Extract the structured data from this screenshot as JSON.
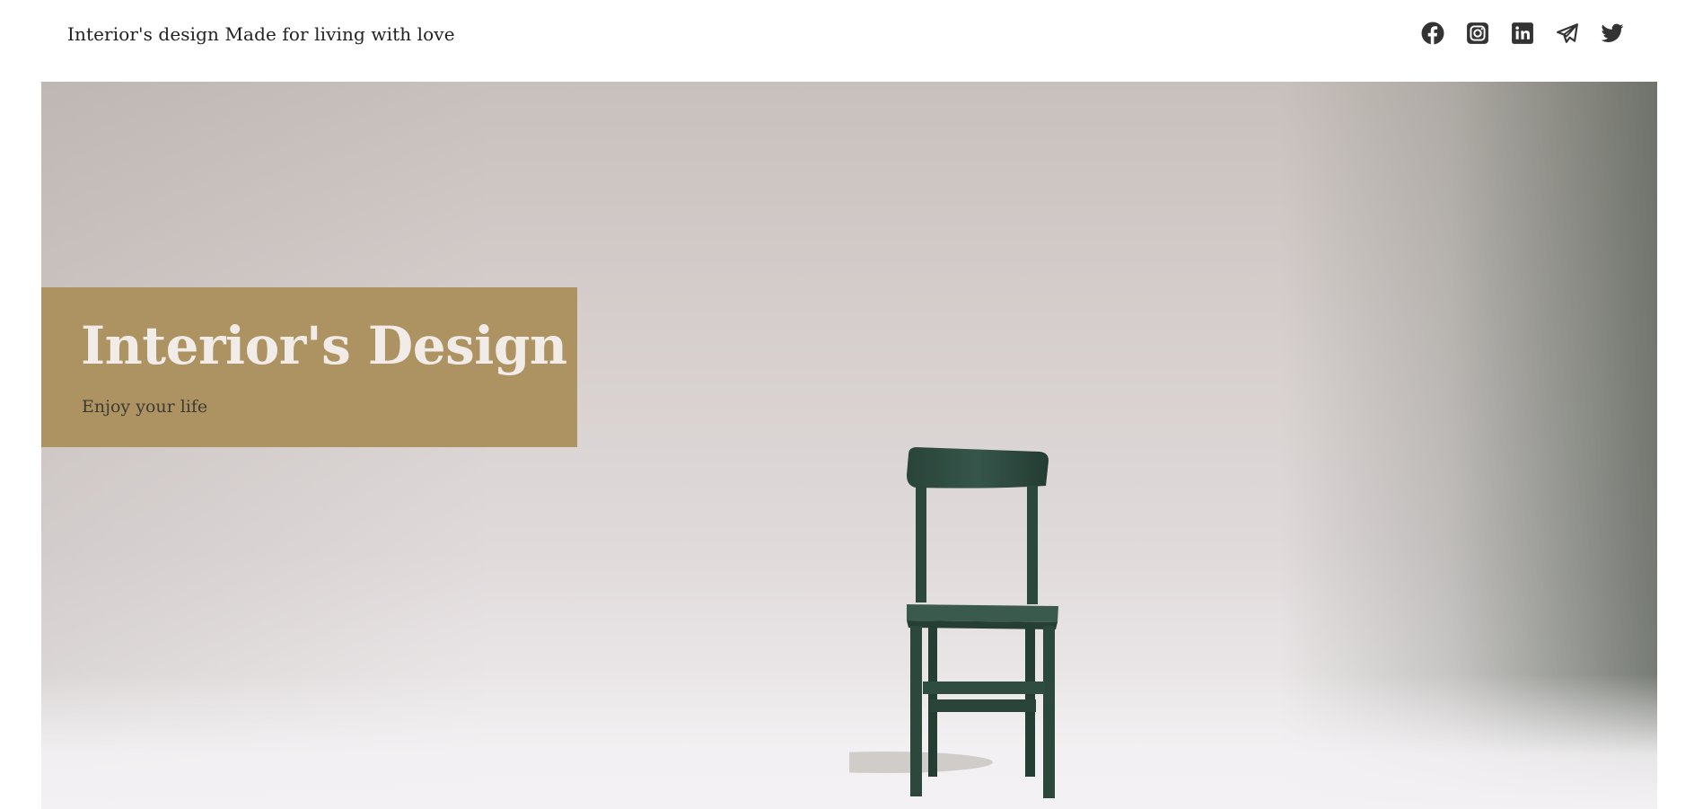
{
  "header": {
    "tagline": "Interior's design Made for living with love",
    "social_links": [
      {
        "name": "facebook",
        "icon": "facebook-icon"
      },
      {
        "name": "instagram",
        "icon": "instagram-icon"
      },
      {
        "name": "linkedin",
        "icon": "linkedin-icon"
      },
      {
        "name": "telegram",
        "icon": "telegram-icon"
      },
      {
        "name": "twitter",
        "icon": "twitter-icon"
      }
    ]
  },
  "hero": {
    "title": "Interior's Design",
    "subtitle": "Enjoy your life",
    "image": "green-chair-photo"
  },
  "colors": {
    "title_box": "#ae9362",
    "title_text": "#f1ece8",
    "icon": "#333333",
    "chair": "#2f4a3f"
  }
}
